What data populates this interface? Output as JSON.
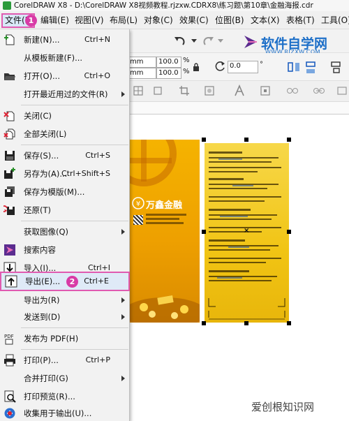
{
  "window": {
    "title": "CorelDRAW X8 - D:\\CorelDRAW X8视频教程.rjzxw.CDRX8\\练习题\\第10章\\金融海报.cdr"
  },
  "menubar": {
    "items": [
      {
        "label": "文件(F)"
      },
      {
        "label": "编辑(E)"
      },
      {
        "label": "视图(V)"
      },
      {
        "label": "布局(L)"
      },
      {
        "label": "对象(C)"
      },
      {
        "label": "效果(C)"
      },
      {
        "label": "位图(B)"
      },
      {
        "label": "文本(X)"
      },
      {
        "label": "表格(T)"
      },
      {
        "label": "工具(O)"
      }
    ]
  },
  "steps": {
    "one": "1",
    "two": "2"
  },
  "toolbar": {
    "unit1": "mm",
    "unit2": "mm",
    "scale_x": "100.0",
    "scale_y": "100.0",
    "pct1": "%",
    "pct2": "%",
    "rotation": "0.0",
    "rotation_unit": "°"
  },
  "watermark": {
    "name": "软件自学网",
    "url": "WWW.RJZXW.COM"
  },
  "file_menu": {
    "items": [
      {
        "label": "新建(N)...",
        "shortcut": "Ctrl+N",
        "icon": "new-document-icon"
      },
      {
        "label": "从模板新建(F)...",
        "shortcut": "",
        "icon": ""
      },
      {
        "label": "打开(O)...",
        "shortcut": "Ctrl+O",
        "icon": "open-folder-icon"
      },
      {
        "label": "打开最近用过的文件(R)",
        "shortcut": "",
        "icon": "",
        "submenu": true
      },
      {
        "label": "关闭(C)",
        "shortcut": "",
        "icon": "close-document-icon"
      },
      {
        "label": "全部关闭(L)",
        "shortcut": "",
        "icon": "close-all-icon"
      },
      {
        "label": "保存(S)...",
        "shortcut": "Ctrl+S",
        "icon": "save-icon"
      },
      {
        "label": "另存为(A)...",
        "shortcut": "Ctrl+Shift+S",
        "icon": "save-as-icon"
      },
      {
        "label": "保存为模版(M)...",
        "shortcut": "",
        "icon": "save-template-icon"
      },
      {
        "label": "还原(T)",
        "shortcut": "",
        "icon": "revert-icon"
      },
      {
        "label": "获取图像(Q)",
        "shortcut": "",
        "icon": "",
        "submenu": true
      },
      {
        "label": "搜索内容",
        "shortcut": "",
        "icon": "search-content-icon"
      },
      {
        "label": "导入(I)...",
        "shortcut": "Ctrl+I",
        "icon": "import-icon"
      },
      {
        "label": "导出(E)...",
        "shortcut": "Ctrl+E",
        "icon": "export-icon"
      },
      {
        "label": "导出为(R)",
        "shortcut": "",
        "icon": "",
        "submenu": true
      },
      {
        "label": "发送到(D)",
        "shortcut": "",
        "icon": "",
        "submenu": true
      },
      {
        "label": "发布为 PDF(H)",
        "shortcut": "",
        "icon": "pdf-icon"
      },
      {
        "label": "打印(P)...",
        "shortcut": "Ctrl+P",
        "icon": "print-icon"
      },
      {
        "label": "合并打印(G)",
        "shortcut": "",
        "icon": "",
        "submenu": true
      },
      {
        "label": "打印预览(R)...",
        "shortcut": "",
        "icon": "print-preview-icon"
      },
      {
        "label": "收集用于输出(U)...",
        "shortcut": "",
        "icon": "collect-output-icon"
      }
    ]
  },
  "poster": {
    "brand": "万鑫金融"
  },
  "footer_watermark": "爱创根知识网"
}
